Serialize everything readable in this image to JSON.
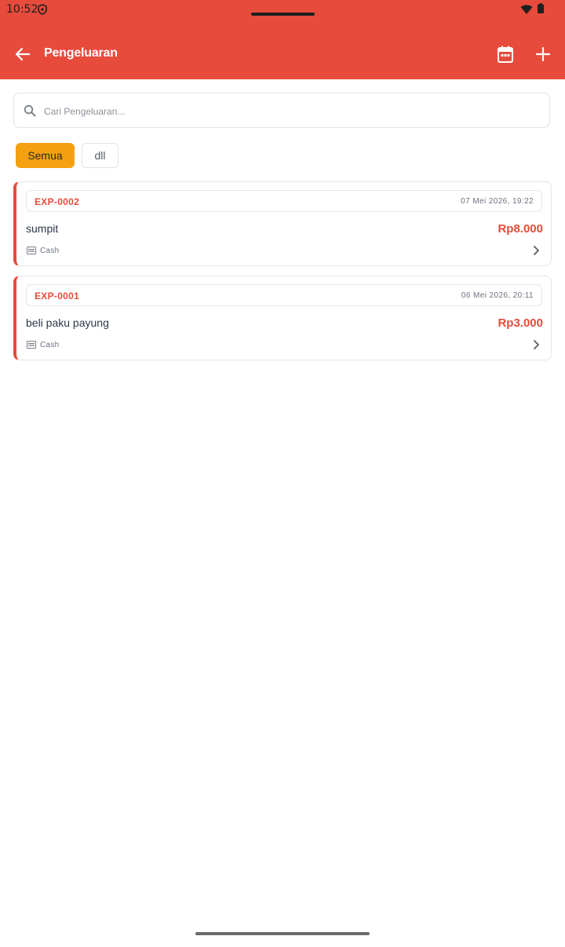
{
  "status_bar": {
    "time": "10:52"
  },
  "app_bar": {
    "title": "Pengeluaran",
    "background_color": "#e64b3c"
  },
  "search": {
    "placeholder": "Cari Pengeluaran...",
    "value": ""
  },
  "filters": [
    {
      "label": "Semua",
      "active": true
    },
    {
      "label": "dll",
      "active": false
    }
  ],
  "expenses": [
    {
      "code": "EXP-0002",
      "date": "07 Mei 2026, 19:22",
      "name": "sumpit",
      "amount": "Rp8.000",
      "method": "Cash"
    },
    {
      "code": "EXP-0001",
      "date": "06 Mei 2026, 20:11",
      "name": "beli paku payung",
      "amount": "Rp3.000",
      "method": "Cash"
    }
  ],
  "icons": {
    "back": "arrow-left-icon",
    "calendar": "calendar-icon",
    "add": "plus-icon",
    "search": "search-icon",
    "cash": "cash-icon",
    "chevron": "chevron-right-icon"
  },
  "colors": {
    "accent": "#e64b3c",
    "chip_active": "#f5a00f"
  }
}
